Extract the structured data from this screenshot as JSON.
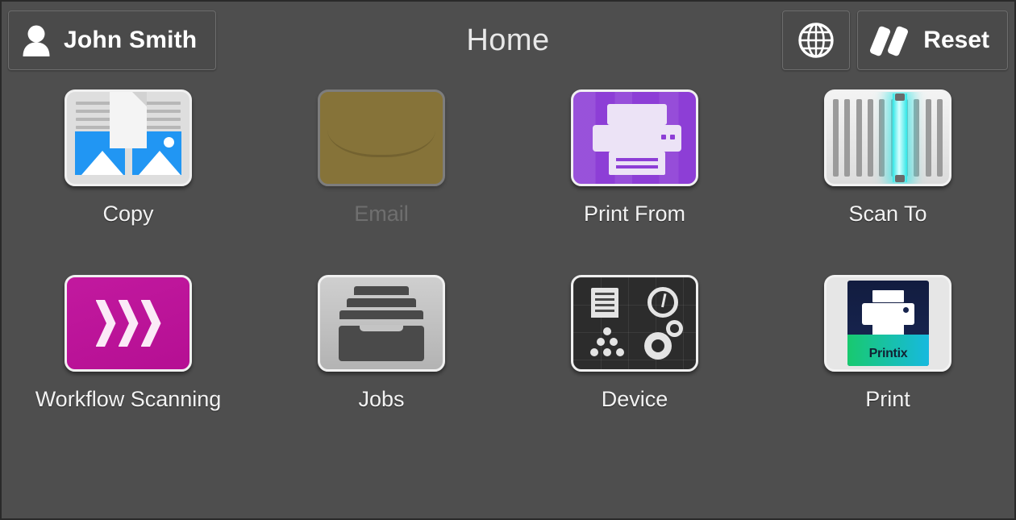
{
  "header": {
    "user_name": "John Smith",
    "user_icon": "person-icon",
    "title": "Home",
    "language_icon": "globe-icon",
    "reset_label": "Reset",
    "reset_icon": "reset-bars-icon"
  },
  "tiles": [
    {
      "label": "Copy",
      "icon": "copy-icon",
      "enabled": true
    },
    {
      "label": "Email",
      "icon": "envelope-icon",
      "enabled": false
    },
    {
      "label": "Print From",
      "icon": "printer-icon",
      "enabled": true
    },
    {
      "label": "Scan To",
      "icon": "scanner-icon",
      "enabled": true
    },
    {
      "label": "Workflow Scanning",
      "icon": "chevrons-icon",
      "enabled": true
    },
    {
      "label": "Jobs",
      "icon": "tray-stack-icon",
      "enabled": true
    },
    {
      "label": "Device",
      "icon": "device-settings-icon",
      "enabled": true
    },
    {
      "label": "Print",
      "icon": "printix-app-icon",
      "enabled": true
    }
  ],
  "printix": {
    "brand": "Printix"
  },
  "colors": {
    "background": "#4e4e4e",
    "header_button": "#4a4a4a",
    "copy_accent": "#2196f3",
    "email_accent": "#b99526",
    "print_from_accent": "#8d3ed6",
    "scan_accent": "#2fe6e6",
    "workflow_accent": "#c2199f",
    "jobs_accent": "#c4c4c4",
    "device_accent": "#2c2c2c",
    "printix_accent": "#16234d",
    "label_text": "#f2f2f2",
    "disabled_text": "#6f6f6f"
  }
}
